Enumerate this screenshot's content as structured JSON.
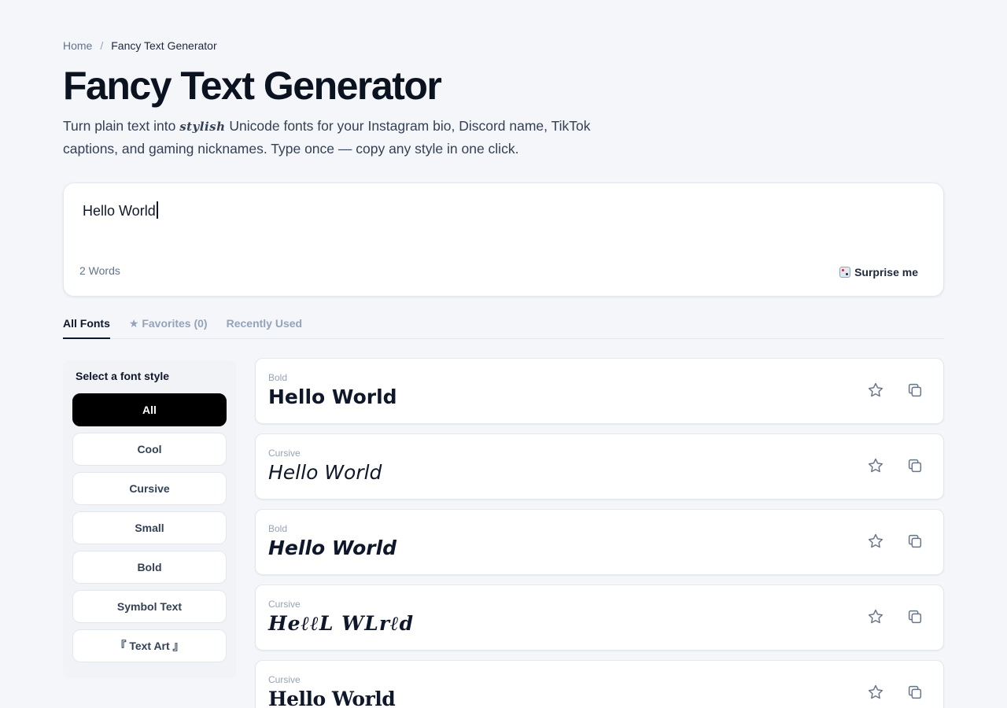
{
  "breadcrumb": {
    "home": "Home",
    "separator": "/",
    "current": "Fancy Text Generator"
  },
  "page": {
    "title": "Fancy Text Generator",
    "description_before": "Turn plain text into ",
    "description_styled": "stylish",
    "description_after": " Unicode fonts for your Instagram bio, Discord name, TikTok captions, and gaming nicknames. Type once — copy any style in one click."
  },
  "editor": {
    "value": "Hello World",
    "word_count": "2 Words",
    "surprise_label": "Surprise me",
    "surprise_icon": "dice-icon"
  },
  "tabs": [
    {
      "label": "All Fonts",
      "active": true
    },
    {
      "label": "★ Favorites (0)",
      "active": false
    },
    {
      "label": "Recently Used",
      "active": false
    }
  ],
  "sidebar": {
    "heading": "Select a font style",
    "items": [
      {
        "label": "All",
        "active": true
      },
      {
        "label": "Cool"
      },
      {
        "label": "Cursive"
      },
      {
        "label": "Small"
      },
      {
        "label": "Bold"
      },
      {
        "label": "Symbol Text"
      },
      {
        "label": "『 Text Art 』"
      }
    ]
  },
  "results": [
    {
      "label": "Bold",
      "sample": "Hello World"
    },
    {
      "label": "Cursive",
      "sample": "Hello World"
    },
    {
      "label": "Bold",
      "sample": "Hello World"
    },
    {
      "label": "Cursive",
      "sample": "HeℓℓL WLrℓd"
    },
    {
      "label": "Cursive",
      "sample": "Hello World"
    }
  ],
  "icons": {
    "favorite": "star-icon",
    "copy": "copy-icon"
  },
  "colors": {
    "accent": "#000000",
    "background": "#f4f6fa",
    "muted": "#94a3b8"
  }
}
